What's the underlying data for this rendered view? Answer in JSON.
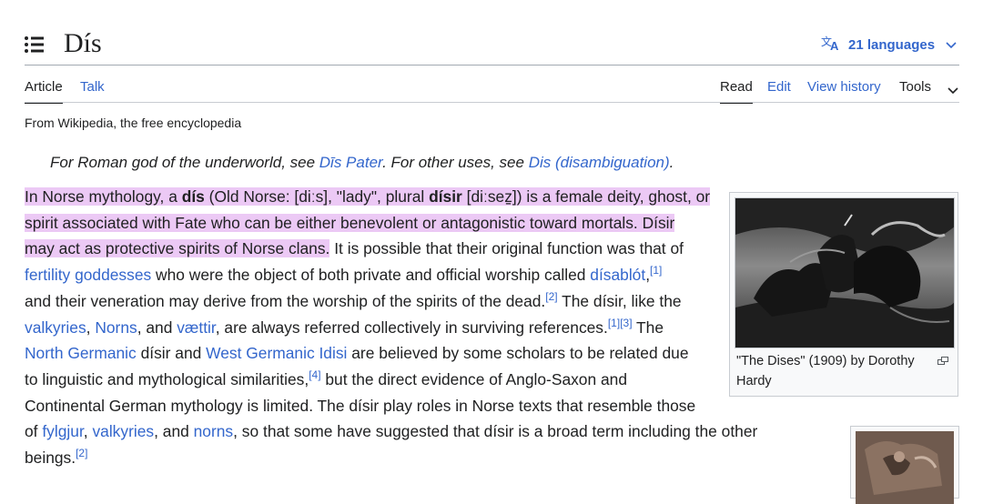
{
  "header": {
    "title": "Dís",
    "languages_label": "21 languages",
    "toc_icon": "list-icon",
    "language_icon": "translate-icon"
  },
  "tabs": {
    "left": [
      {
        "label": "Article",
        "selected": true
      },
      {
        "label": "Talk",
        "selected": false
      }
    ],
    "right": [
      {
        "label": "Read",
        "selected": true
      },
      {
        "label": "Edit",
        "selected": false
      },
      {
        "label": "View history",
        "selected": false
      },
      {
        "label": "Tools",
        "selected": false
      }
    ]
  },
  "tagline": "From Wikipedia, the free encyclopedia",
  "hatnote": {
    "part1": "For Roman god of the underworld, see ",
    "link1": "Dīs Pater",
    "part2": ". For other uses, see ",
    "link2": "Dis (disambiguation)",
    "part3": "."
  },
  "body": {
    "l1_a": "In Norse mythology, a ",
    "l1_b": "dís",
    "l1_c": " (Old Norse: [diːs], \"lady\", plural ",
    "l1_d": "dísir",
    "l1_e": " [diːsez̠]) is a female deity, ghost, or",
    "l2": "spirit associated with Fate who can be either benevolent or antagonistic toward mortals. Dísir",
    "l3_hl": "may act as protective spirits of Norse clans.",
    "l3_rest": " It is possible that their original function was that of",
    "l4_link1": "fertility goddesses",
    "l4_mid": " who were the object of both private and official worship called ",
    "l4_link2": "dísablót",
    "l4_comma": ",",
    "l4_ref": "[1]",
    "l5_a": "and their veneration may derive from the worship of the spirits of the dead.",
    "l5_ref": "[2]",
    "l5_b": " The dísir, like the",
    "l6_link1": "valkyries",
    "l6_sep1": ", ",
    "l6_link2": "Norns",
    "l6_sep2": ", and ",
    "l6_link3": "vættir",
    "l6_mid": ", are always referred collectively in surviving references.",
    "l6_ref1": "[1]",
    "l6_ref2": "[3]",
    "l6_end": " The",
    "l7_link1": "North Germanic",
    "l7_mid": " dísir and ",
    "l7_link2": "West Germanic Idisi",
    "l7_end": " are believed by some scholars to be related due",
    "l8_a": "to linguistic and mythological similarities,",
    "l8_ref": "[4]",
    "l8_b": " but the direct evidence of Anglo-Saxon and",
    "l9": "Continental German mythology is limited. The dísir play roles in Norse texts that resemble those",
    "l10_a": "of ",
    "l10_link1": "fylgjur",
    "l10_sep1": ", ",
    "l10_link2": "valkyries",
    "l10_sep2": ", and ",
    "l10_link3": "norns",
    "l10_end": ", so that some have suggested that dísir is a broad term including the other",
    "l11": "beings.",
    "l11_ref": "[2]"
  },
  "figure": {
    "caption": "\"The Dises\" (1909) by Dorothy Hardy",
    "enlarge_icon": "enlarge-icon"
  },
  "colors": {
    "link": "#3366cc",
    "highlight": "#ecc9f5",
    "text": "#202122"
  }
}
